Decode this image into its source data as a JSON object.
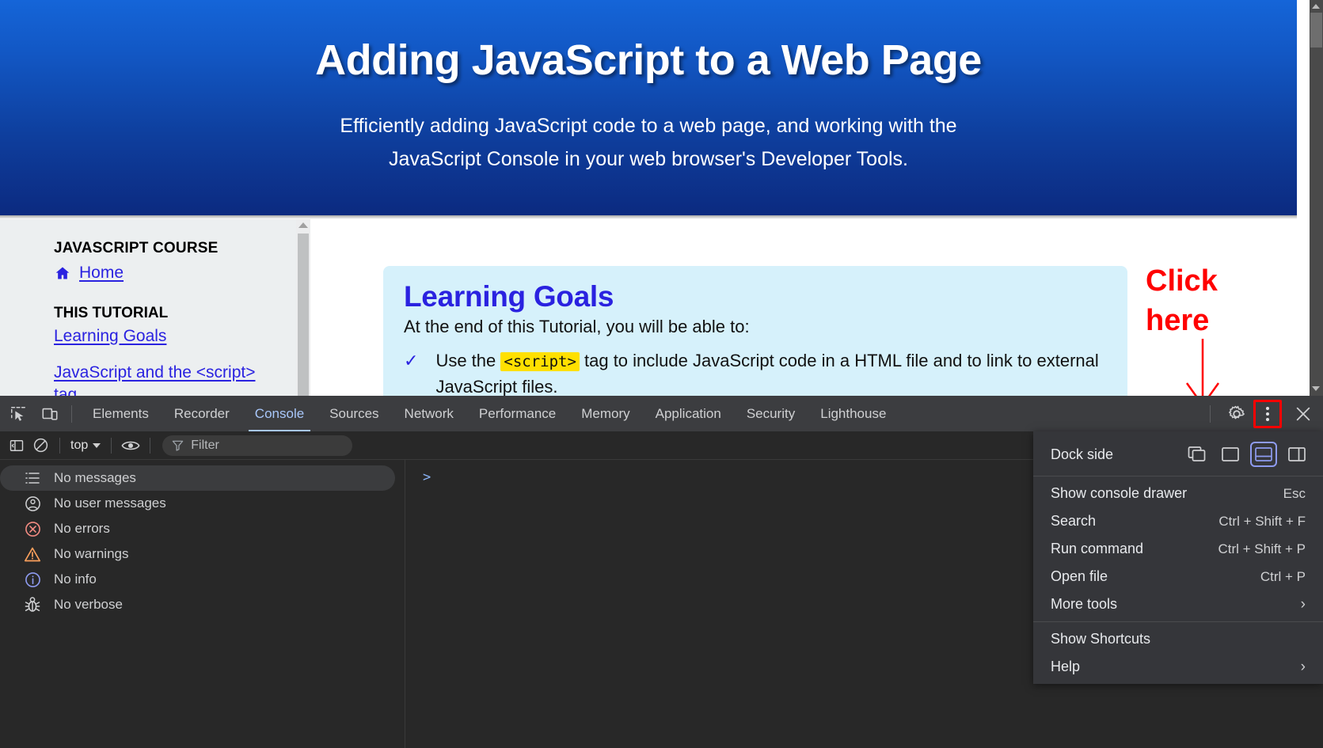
{
  "hero": {
    "title": "Adding JavaScript to a Web Page",
    "subtitle_line1": "Efficiently adding JavaScript code to a web page, and working with the",
    "subtitle_line2": "JavaScript Console in your web browser's Developer Tools."
  },
  "sidebar": {
    "course_heading": "JAVASCRIPT COURSE",
    "home_label": "Home",
    "tutorial_heading": "THIS TUTORIAL",
    "links": [
      {
        "label": "Learning Goals"
      },
      {
        "label": "JavaScript and the <script> tag"
      }
    ]
  },
  "content": {
    "goals_title": "Learning Goals",
    "goals_intro": "At the end of this Tutorial, you will be able to:",
    "goal_check": "✓",
    "goal_text_before": "Use the ",
    "goal_code": "<script>",
    "goal_text_after": " tag to include JavaScript code in a HTML file and to link to external JavaScript files."
  },
  "annotation": {
    "line1": "Click",
    "line2": "here"
  },
  "devtools": {
    "tabs": [
      {
        "label": "Elements",
        "active": false
      },
      {
        "label": "Recorder",
        "active": false
      },
      {
        "label": "Console",
        "active": true
      },
      {
        "label": "Sources",
        "active": false
      },
      {
        "label": "Network",
        "active": false
      },
      {
        "label": "Performance",
        "active": false
      },
      {
        "label": "Memory",
        "active": false
      },
      {
        "label": "Application",
        "active": false
      },
      {
        "label": "Security",
        "active": false
      },
      {
        "label": "Lighthouse",
        "active": false
      }
    ],
    "left_icons": [
      {
        "name": "inspect-element-icon"
      },
      {
        "name": "device-toolbar-icon"
      }
    ],
    "right_icons": [
      {
        "name": "settings-gear-icon"
      },
      {
        "name": "more-options-icon"
      },
      {
        "name": "close-devtools-icon"
      }
    ],
    "console_toolbar": {
      "sidebar_toggle": "console-sidebar-toggle-icon",
      "clear_console": "clear-console-icon",
      "context_selector": "top",
      "eye_icon": "live-expression-eye-icon",
      "filter_placeholder": "Filter",
      "filter_icon": "filter-funnel-icon"
    },
    "console_sidebar": [
      {
        "label": "No messages",
        "icon": "list-icon",
        "selected": true
      },
      {
        "label": "No user messages",
        "icon": "user-icon",
        "selected": false
      },
      {
        "label": "No errors",
        "icon": "error-circle-icon",
        "selected": false
      },
      {
        "label": "No warnings",
        "icon": "warning-triangle-icon",
        "selected": false
      },
      {
        "label": "No info",
        "icon": "info-circle-icon",
        "selected": false
      },
      {
        "label": "No verbose",
        "icon": "bug-icon",
        "selected": false
      }
    ],
    "prompt_symbol": ">",
    "menu": {
      "dock_label": "Dock side",
      "dock_options": [
        {
          "name": "undock-into-separate-window",
          "active": false
        },
        {
          "name": "dock-to-left",
          "active": false
        },
        {
          "name": "dock-to-bottom",
          "active": true
        },
        {
          "name": "dock-to-right",
          "active": false
        }
      ],
      "items": [
        {
          "label": "Show console drawer",
          "shortcut": "Esc",
          "arrow": ""
        },
        {
          "label": "Search",
          "shortcut": "Ctrl + Shift + F",
          "arrow": ""
        },
        {
          "label": "Run command",
          "shortcut": "Ctrl + Shift + P",
          "arrow": ""
        },
        {
          "label": "Open file",
          "shortcut": "Ctrl + P",
          "arrow": ""
        },
        {
          "label": "More tools",
          "shortcut": "",
          "arrow": "›"
        }
      ],
      "items2": [
        {
          "label": "Show Shortcuts",
          "shortcut": "",
          "arrow": ""
        },
        {
          "label": "Help",
          "shortcut": "",
          "arrow": "›"
        }
      ]
    }
  },
  "colors": {
    "hero_top": "#1565d8",
    "hero_bottom": "#0c2a80",
    "link_blue": "#2a22e0",
    "goals_box": "#d6f1fb",
    "code_highlight": "#ffe000",
    "annotation_red": "#ff0000",
    "devtools_bg": "#282828",
    "devtools_tabbar": "#3c3d40",
    "accent_blue": "#a8c7fa",
    "menu_bg": "#35363a"
  }
}
